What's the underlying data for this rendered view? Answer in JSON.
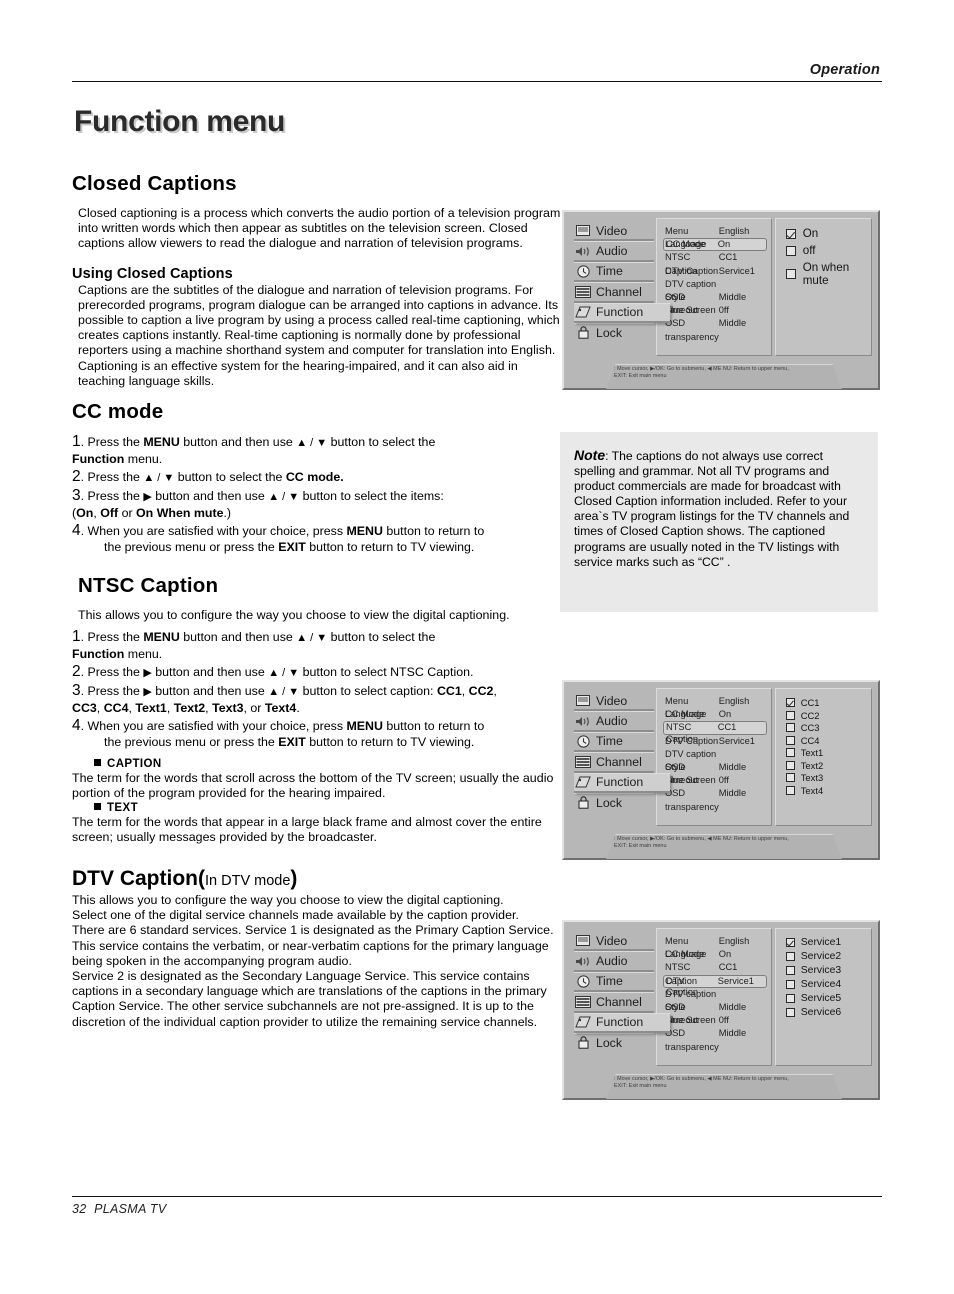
{
  "header": {
    "section_label": "Operation",
    "page_title": "Function menu"
  },
  "closed_captions": {
    "heading": "Closed Captions",
    "intro": "Closed captioning is a process which converts the audio portion of a television program into written words which then appear as subtitles on the television screen. Closed captions allow viewers to read the dialogue and narration of television programs.",
    "using_heading": "Using Closed Captions",
    "using_body": "Captions are the subtitles of the dialogue and narration of television programs. For prerecorded programs, program dialogue can be arranged into captions in advance. Its possible to caption a live program by using a process called real-time captioning, which creates captions instantly. Real-time captioning is normally done by professional reporters using a machine shorthand system and computer for translation into English. Captioning is an effective system for the hearing-impaired, and it can also aid in teaching language skills."
  },
  "cc_mode": {
    "heading": "CC mode",
    "step1_a": "Press the ",
    "step1_menu": "MENU",
    "step1_b": " button and then use ",
    "step1_arrows": "▲ / ▼",
    "step1_c": " button to select the ",
    "step1_function": "Function",
    "step1_d": " menu.",
    "step2_a": "Press the ",
    "step2_arrows": "▲ / ▼",
    "step2_b": " button to select the ",
    "step2_target": "CC mode.",
    "step3_a": "Press the ",
    "step3_right": "▶",
    "step3_b": " button and then use ",
    "step3_arrows": "▲ / ▼",
    "step3_c": " button to select the  items:",
    "step3_items_pre": "(",
    "step3_on": "On",
    "step3_sep1": ", ",
    "step3_off": "Off",
    "step3_sep2": " or ",
    "step3_mute": "On When mute",
    "step3_items_post": ".)",
    "step4_a": "When you are satisfied with your choice,  press ",
    "step4_menu": "MENU",
    "step4_b": " button to return to",
    "step4_c": "the previous menu or press the ",
    "step4_exit": "EXIT",
    "step4_d": " button to return to TV viewing."
  },
  "ntsc_caption": {
    "heading": "NTSC Caption",
    "intro": "This allows you to configure the way you choose to view the digital captioning.",
    "step1_a": "Press the ",
    "step1_menu": "MENU",
    "step1_b": " button and then use ",
    "step1_arrows": "▲ / ▼",
    "step1_c": " button to select the ",
    "step1_function": "Function",
    "step1_d": " menu.",
    "step2_a": "Press the ",
    "step2_right": "▶",
    "step2_b": " button and then use ",
    "step2_arrows": "▲ / ▼",
    "step2_c": " button to select NTSC Caption.",
    "step3_a": "Press the ",
    "step3_right": "▶",
    "step3_b": " button and then use ",
    "step3_arrows": "▲ / ▼",
    "step3_c": " button to select caption: ",
    "step3_items1": "CC1",
    "step3_items2": "CC2",
    "step3_items3": "CC3",
    "step3_items4": "CC4",
    "step3_items5": "Text1",
    "step3_items6": "Text2",
    "step3_items7": "Text3",
    "step3_items8": "Text4",
    "step3_or": ", or ",
    "step3_end": ".",
    "step4_a": "When you are satisfied with your choice,  press ",
    "step4_menu": "MENU",
    "step4_b": " button to return to",
    "step4_c": "the previous menu or press the ",
    "step4_exit": "EXIT",
    "step4_d": " button to return to TV viewing.",
    "caption_term_head": "CAPTION",
    "caption_term_body": "The term for the words that scroll across the bottom of the TV screen; usually the audio portion of the program provided for the hearing impaired.",
    "text_term_head": "TEXT",
    "text_term_body": "The term for the words that appear in a large black frame and almost cover the entire screen; usually messages provided by the broadcaster."
  },
  "dtv_caption": {
    "heading_main": "DTV Caption",
    "heading_paren_open": "(",
    "heading_sub": "In DTV mode",
    "heading_paren_close": ")",
    "body": "This allows you to configure the way you choose to view the digital captioning.\nSelect one of the digital service channels made available by the caption provider.\nThere are 6 standard services. Service 1 is designated as the Primary Caption Service. This service contains the verbatim, or near-verbatim captions for the primary language being spoken in the accompanying program audio.\nService 2 is designated as the Secondary Language Service. This service contains captions in a secondary language which are translations of the captions in the primary Caption Service. The other service subchannels are not pre-assigned. It is up to the discretion of the individual caption provider to utilize the remaining service channels."
  },
  "note": {
    "label": "Note",
    "text": ": The captions do not always use correct spelling and grammar. Not all TV programs and product commercials are made for broadcast with Closed Caption information included. Refer to your area`s TV program listings for the TV channels and times of Closed Caption shows. The captioned programs are usually noted in the TV listings with service marks such as  “CC” ."
  },
  "osd": {
    "nav": [
      {
        "label": "Video",
        "icon": "video-icon"
      },
      {
        "label": "Audio",
        "icon": "audio-icon"
      },
      {
        "label": "Time",
        "icon": "clock-icon"
      },
      {
        "label": "Channel",
        "icon": "channel-icon"
      },
      {
        "label": "Function",
        "icon": "tag-icon"
      },
      {
        "label": "Lock",
        "icon": "lock-icon"
      }
    ],
    "menu_items": [
      {
        "key": "Menu Language",
        "value": "English"
      },
      {
        "key": "CC Mode",
        "value": "On"
      },
      {
        "key": "NTSC Caption",
        "value": "CC1"
      },
      {
        "key": "DTV Caption",
        "value": "Service1"
      },
      {
        "key": "DTV caption Style",
        "value": ""
      },
      {
        "key": "OSD Timeout",
        "value": "Middle"
      },
      {
        "key": "Blue Screen",
        "value": "0ff"
      },
      {
        "key": "OSD transparency",
        "value": "Middle"
      }
    ],
    "footer_line1": ": Move cursor,  ▶/OK: Go to submenu,  ◀ ME NU: Return to upper menu,",
    "footer_line2": "EXIT: Exit main menu",
    "panel1": {
      "selected_row": 1,
      "options": [
        {
          "label": "On",
          "checked": true
        },
        {
          "label": "off",
          "checked": false
        },
        {
          "label": "On when mute",
          "checked": false
        }
      ]
    },
    "panel2": {
      "selected_row": 2,
      "options": [
        {
          "label": "CC1",
          "checked": true
        },
        {
          "label": "CC2",
          "checked": false
        },
        {
          "label": "CC3",
          "checked": false
        },
        {
          "label": "CC4",
          "checked": false
        },
        {
          "label": "Text1",
          "checked": false
        },
        {
          "label": "Text2",
          "checked": false
        },
        {
          "label": "Text3",
          "checked": false
        },
        {
          "label": "Text4",
          "checked": false
        }
      ]
    },
    "panel3": {
      "selected_row": 3,
      "options": [
        {
          "label": "Service1",
          "checked": true
        },
        {
          "label": "Service2",
          "checked": false
        },
        {
          "label": "Service3",
          "checked": false
        },
        {
          "label": "Service4",
          "checked": false
        },
        {
          "label": "Service5",
          "checked": false
        },
        {
          "label": "Service6",
          "checked": false
        }
      ]
    }
  },
  "footer": {
    "page_number": "32",
    "product": "PLASMA TV"
  }
}
